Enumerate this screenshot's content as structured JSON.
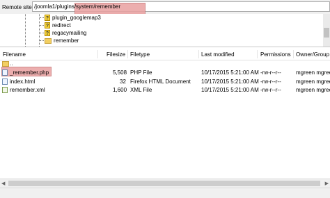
{
  "remote_site": {
    "label": "Remote site:",
    "path": "/joomla1/plugins/system/remember"
  },
  "tree": {
    "items": [
      {
        "label": "plugin_googlemap3",
        "icon": "question-folder-icon"
      },
      {
        "label": "redirect",
        "icon": "question-folder-icon"
      },
      {
        "label": "regacymailing",
        "icon": "question-folder-icon"
      },
      {
        "label": "remember",
        "icon": "folder-icon"
      }
    ]
  },
  "columns": {
    "filename": "Filename",
    "filesize": "Filesize",
    "filetype": "Filetype",
    "modified": "Last modified",
    "permissions": "Permissions",
    "owner": "Owner/Group"
  },
  "parent_dir": "..",
  "files": [
    {
      "name": "_remember.php",
      "size": "5,508",
      "type": "PHP File",
      "modified": "10/17/2015 5:21:00 AM",
      "perms": "-rw-r--r--",
      "owner": "mgreen mgreen"
    },
    {
      "name": "index.html",
      "size": "32",
      "type": "Firefox HTML Document",
      "modified": "10/17/2015 5:21:00 AM",
      "perms": "-rw-r--r--",
      "owner": "mgreen mgreen"
    },
    {
      "name": "remember.xml",
      "size": "1,600",
      "type": "XML File",
      "modified": "10/17/2015 5:21:00 AM",
      "perms": "-rw-r--r--",
      "owner": "mgreen mgreen"
    }
  ],
  "colors": {
    "highlight": "#e9a0a0"
  }
}
